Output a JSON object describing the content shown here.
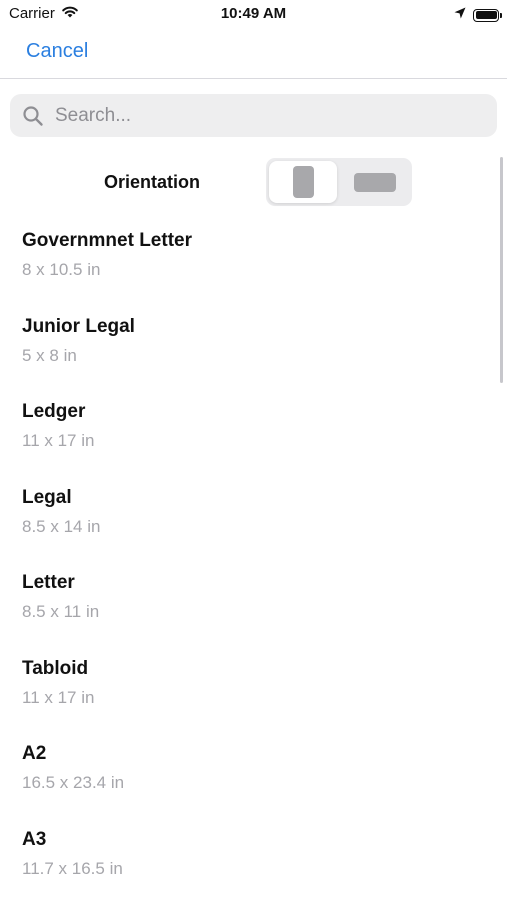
{
  "status_bar": {
    "carrier": "Carrier",
    "time": "10:49 AM",
    "icons": [
      "wifi-icon",
      "location-arrow-icon",
      "battery-icon"
    ]
  },
  "nav": {
    "cancel_label": "Cancel",
    "accent_color": "#2b7fe0"
  },
  "search": {
    "placeholder": "Search...",
    "value": "",
    "icon": "search-icon"
  },
  "orientation": {
    "label": "Orientation",
    "options": [
      "portrait",
      "landscape"
    ],
    "selected": "portrait"
  },
  "paper_sizes": [
    {
      "name": "Governmnet Letter",
      "size": "8 x 10.5 in"
    },
    {
      "name": "Junior Legal",
      "size": "5 x 8 in"
    },
    {
      "name": "Ledger",
      "size": "11 x 17 in"
    },
    {
      "name": "Legal",
      "size": "8.5 x 14 in"
    },
    {
      "name": "Letter",
      "size": "8.5 x 11 in"
    },
    {
      "name": "Tabloid",
      "size": "11 x 17 in"
    },
    {
      "name": "A2",
      "size": "16.5 x 23.4 in"
    },
    {
      "name": "A3",
      "size": "11.7 x 16.5 in"
    }
  ]
}
